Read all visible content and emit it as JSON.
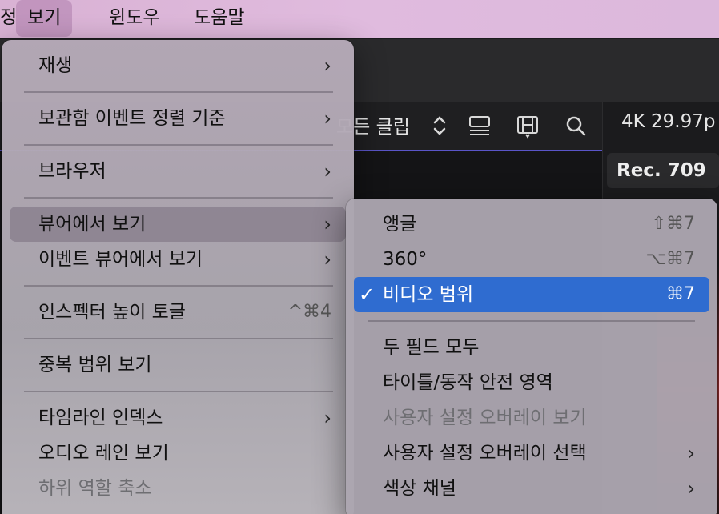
{
  "menubar": {
    "items": [
      {
        "label": "정"
      },
      {
        "label": "보기"
      },
      {
        "label": "윈도우"
      },
      {
        "label": "도움말"
      }
    ]
  },
  "toolbar": {
    "clip_filter": "모든 클립",
    "resolution": "4K 29.97p",
    "color_space": "Rec. 709"
  },
  "view_menu": {
    "items": [
      {
        "label": "재생",
        "submenu": true
      },
      {
        "label": "보관함 이벤트 정렬 기준",
        "submenu": true
      },
      {
        "label": "브라우저",
        "submenu": true
      },
      {
        "label": "뷰어에서 보기",
        "submenu": true,
        "highlighted": true
      },
      {
        "label": "이벤트 뷰어에서 보기",
        "submenu": true
      },
      {
        "label": "인스펙터 높이 토글",
        "shortcut": "^⌘4"
      },
      {
        "label": "중복 범위 보기"
      },
      {
        "label": "타임라인 인덱스",
        "submenu": true
      },
      {
        "label": "오디오 레인 보기"
      },
      {
        "label": "하위 역할 축소",
        "disabled": true
      }
    ]
  },
  "viewer_submenu": {
    "items": [
      {
        "label": "앵글",
        "shortcut": "⇧⌘7"
      },
      {
        "label": "360°",
        "shortcut": "⌥⌘7"
      },
      {
        "label": "비디오 범위",
        "shortcut": "⌘7",
        "checked": true,
        "selected": true
      },
      {
        "label": "두 필드 모두"
      },
      {
        "label": "타이틀/동작 안전 영역"
      },
      {
        "label": "사용자 설정 오버레이 보기",
        "disabled": true
      },
      {
        "label": "사용자 설정 오버레이 선택",
        "submenu": true
      },
      {
        "label": "색상 채널",
        "submenu": true
      }
    ]
  },
  "glyphs": {
    "arrow": "›",
    "check": "✓",
    "updown": "⌃⌄"
  },
  "colors": {
    "selection": "#2f6cd0",
    "toolbar_accent": "#5a55c8"
  },
  "icons": [
    "chevron-updown-icon",
    "list-view-icon",
    "filmstrip-icon",
    "search-icon"
  ]
}
